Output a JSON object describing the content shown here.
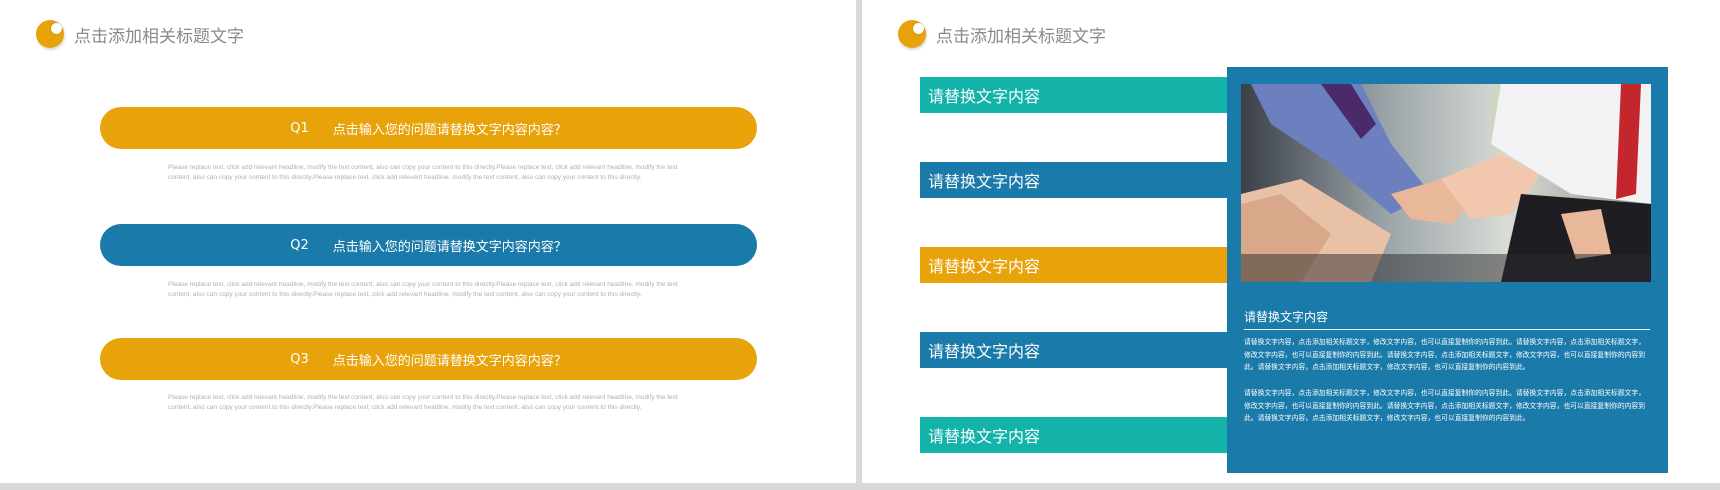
{
  "colors": {
    "orange": "#e8a20a",
    "blue": "#1a7aaa",
    "teal": "#14b3aa",
    "white": "#ffffff"
  },
  "left_slide": {
    "title": "点击添加相关标题文字",
    "questions": [
      {
        "number": "Q1",
        "text": "点击输入您的问题请替换文字内容内容？",
        "color": "#e8a20a",
        "description": "Please replace text, click add relevant headline, modify the text content, also can copy your content to this directly.Please replace text, click add relevant headline, modify the text content, also can copy your content to this directly.Please replace text, click add relevant headline, modify the text content, also can copy your content to this directly."
      },
      {
        "number": "Q2",
        "text": "点击输入您的问题请替换文字内容内容？",
        "color": "#1a7aaa",
        "description": "Please replace text, click add relevant headline, modify the text content, also can copy your content to this directly.Please replace text, click add relevant headline, modify the text content, also can copy your content to this directly.Please replace text, click add relevant headline, modify the text content, also can copy your content to this directly."
      },
      {
        "number": "Q3",
        "text": "点击输入您的问题请替换文字内容内容？",
        "color": "#e8a20a",
        "description": "Please replace text, click add relevant headline, modify the text content, also can copy your content to this directly.Please replace text, click add relevant headline, modify the text content, also can copy your content to this directly.Please replace text, click add relevant headline, modify the text content, also can copy your content to this directly."
      }
    ]
  },
  "right_slide": {
    "title": "点击添加相关标题文字",
    "bars": [
      {
        "label": "请替换文字内容",
        "color": "#14b3aa"
      },
      {
        "label": "请替换文字内容",
        "color": "#1a7aaa"
      },
      {
        "label": "请替换文字内容",
        "color": "#e8a20a"
      },
      {
        "label": "请替换文字内容",
        "color": "#1a7aaa"
      },
      {
        "label": "请替换文字内容",
        "color": "#14b3aa"
      }
    ],
    "panel": {
      "heading": "请替换文字内容",
      "paragraph1": "请替换文字内容，点击添加相关标题文字，修改文字内容，也可以直接复制你的内容到此。请替换文字内容，点击添加相关标题文字，修改文字内容，也可以直接复制你的内容到此。请替换文字内容，点击添加相关标题文字，修改文字内容，也可以直接复制你的内容到此。请替换文字内容，点击添加相关标题文字，修改文字内容，也可以直接复制你的内容到此。",
      "paragraph2": "请替换文字内容，点击添加相关标题文字，修改文字内容，也可以直接复制你的内容到此。请替换文字内容，点击添加相关标题文字，修改文字内容，也可以直接复制你的内容到此。请替换文字内容，点击添加相关标题文字，修改文字内容，也可以直接复制你的内容到此。请替换文字内容，点击添加相关标题文字，修改文字内容，也可以直接复制你的内容到此。"
    }
  }
}
